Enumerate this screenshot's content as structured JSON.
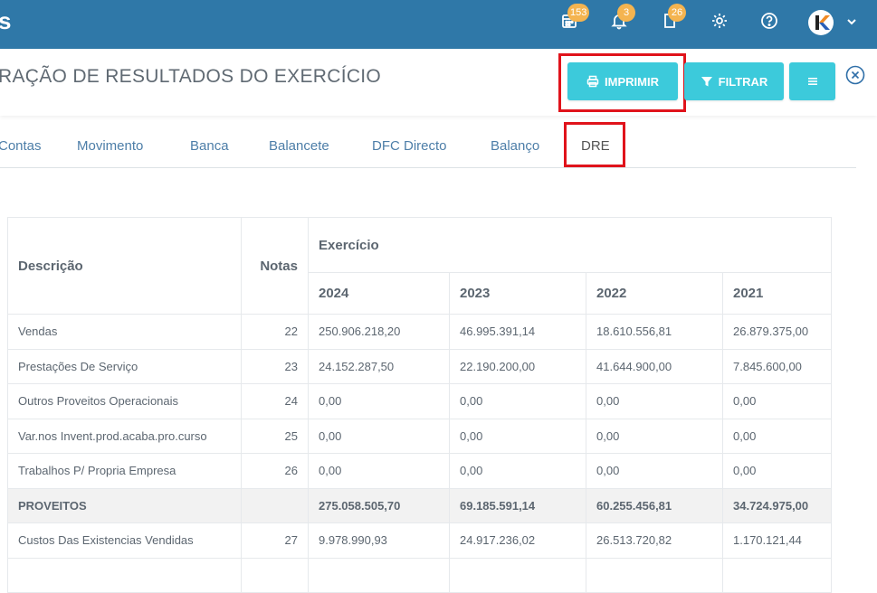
{
  "topbar": {
    "brand": "s",
    "calendar_badge": "153",
    "bell_badge": "3",
    "doc_badge": "26",
    "avatar_letter": "K"
  },
  "header": {
    "title": "RAÇÃO DE RESULTADOS DO EXERCÍCIO",
    "print_label": "IMPRIMIR",
    "filter_label": "FILTRAR"
  },
  "tabs": [
    "Contas",
    "Movimento",
    "Banca",
    "Balancete",
    "DFC Directo",
    "Balanço",
    "DRE"
  ],
  "table": {
    "col_descricao": "Descrição",
    "col_notas": "Notas",
    "col_exercicio": "Exercício",
    "years": [
      "2024",
      "2023",
      "2022",
      "2021"
    ],
    "rows": [
      {
        "desc": "Vendas",
        "nota": "22",
        "v": [
          "250.906.218,20",
          "46.995.391,14",
          "18.610.556,81",
          "26.879.375,00"
        ]
      },
      {
        "desc": "Prestações De Serviço",
        "nota": "23",
        "v": [
          "24.152.287,50",
          "22.190.200,00",
          "41.644.900,00",
          "7.845.600,00"
        ]
      },
      {
        "desc": "Outros Proveitos Operacionais",
        "nota": "24",
        "v": [
          "0,00",
          "0,00",
          "0,00",
          "0,00"
        ]
      },
      {
        "desc": "Var.nos Invent.prod.acaba.pro.curso",
        "nota": "25",
        "v": [
          "0,00",
          "0,00",
          "0,00",
          "0,00"
        ]
      },
      {
        "desc": "Trabalhos P/ Propria Empresa",
        "nota": "26",
        "v": [
          "0,00",
          "0,00",
          "0,00",
          "0,00"
        ]
      },
      {
        "desc": "PROVEITOS",
        "nota": "",
        "v": [
          "275.058.505,70",
          "69.185.591,14",
          "60.255.456,81",
          "34.724.975,00"
        ],
        "total": true
      },
      {
        "desc": "Custos Das Existencias Vendidas",
        "nota": "27",
        "v": [
          "9.978.990,93",
          "24.917.236,02",
          "26.513.720,82",
          "1.170.121,44"
        ]
      }
    ]
  }
}
